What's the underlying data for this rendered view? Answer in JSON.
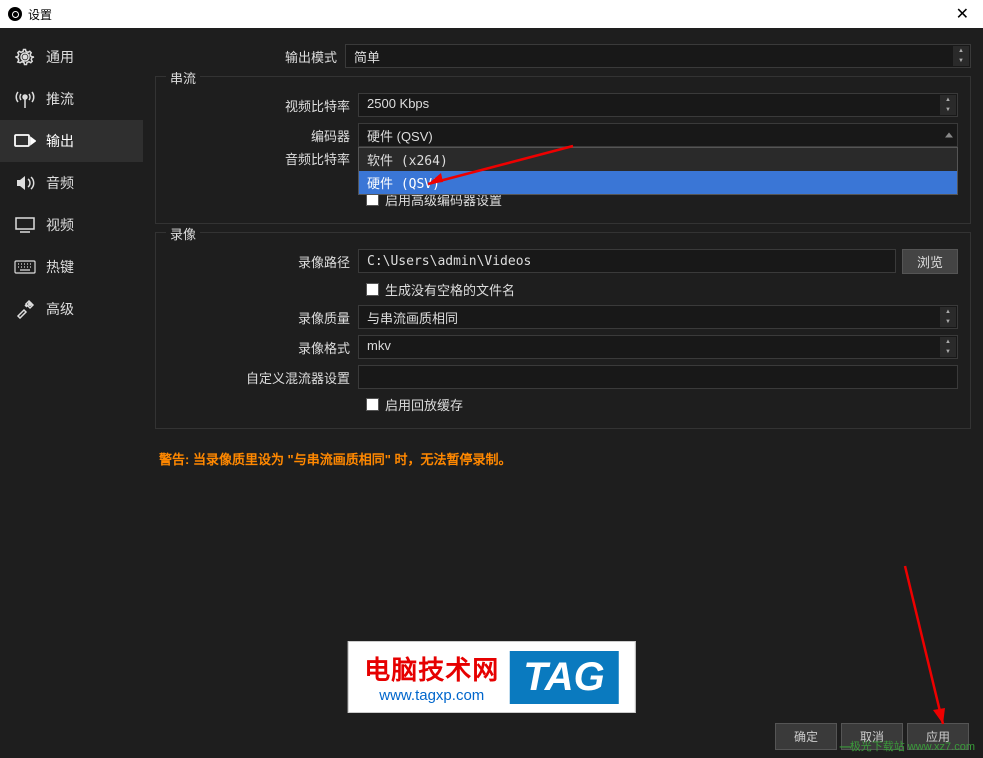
{
  "window": {
    "title": "设置"
  },
  "sidebar": {
    "items": [
      {
        "label": "通用",
        "icon": "gear-icon"
      },
      {
        "label": "推流",
        "icon": "antenna-icon"
      },
      {
        "label": "输出",
        "icon": "output-icon"
      },
      {
        "label": "音频",
        "icon": "speaker-icon"
      },
      {
        "label": "视频",
        "icon": "monitor-icon"
      },
      {
        "label": "热键",
        "icon": "keyboard-icon"
      },
      {
        "label": "高级",
        "icon": "tools-icon"
      }
    ]
  },
  "output_mode": {
    "label": "输出模式",
    "value": "简单"
  },
  "stream": {
    "title": "串流",
    "video_bitrate": {
      "label": "视频比特率",
      "value": "2500 Kbps"
    },
    "encoder": {
      "label": "编码器",
      "value": "硬件 (QSV)",
      "options": [
        {
          "label": "软件 (x264)",
          "highlight": false
        },
        {
          "label": "硬件 (QSV)",
          "highlight": true
        }
      ]
    },
    "audio_bitrate": {
      "label": "音频比特率"
    },
    "adv_encoder": {
      "label": "启用高级编码器设置"
    }
  },
  "record": {
    "title": "录像",
    "path": {
      "label": "录像路径",
      "value": "C:\\Users\\admin\\Videos",
      "browse": "浏览"
    },
    "no_space": {
      "label": "生成没有空格的文件名"
    },
    "quality": {
      "label": "录像质量",
      "value": "与串流画质相同"
    },
    "format": {
      "label": "录像格式",
      "value": "mkv"
    },
    "muxer": {
      "label": "自定义混流器设置",
      "value": ""
    },
    "replay": {
      "label": "启用回放缓存"
    }
  },
  "warning": "警告: 当录像质里设为 \"与串流画质相同\" 时，无法暂停录制。",
  "buttons": {
    "ok": "确定",
    "cancel": "取消",
    "apply": "应用"
  },
  "watermark": {
    "title": "电脑技术网",
    "url": "www.tagxp.com",
    "tag": "TAG",
    "corner": "极光下载站\nwww.xz7.com"
  }
}
